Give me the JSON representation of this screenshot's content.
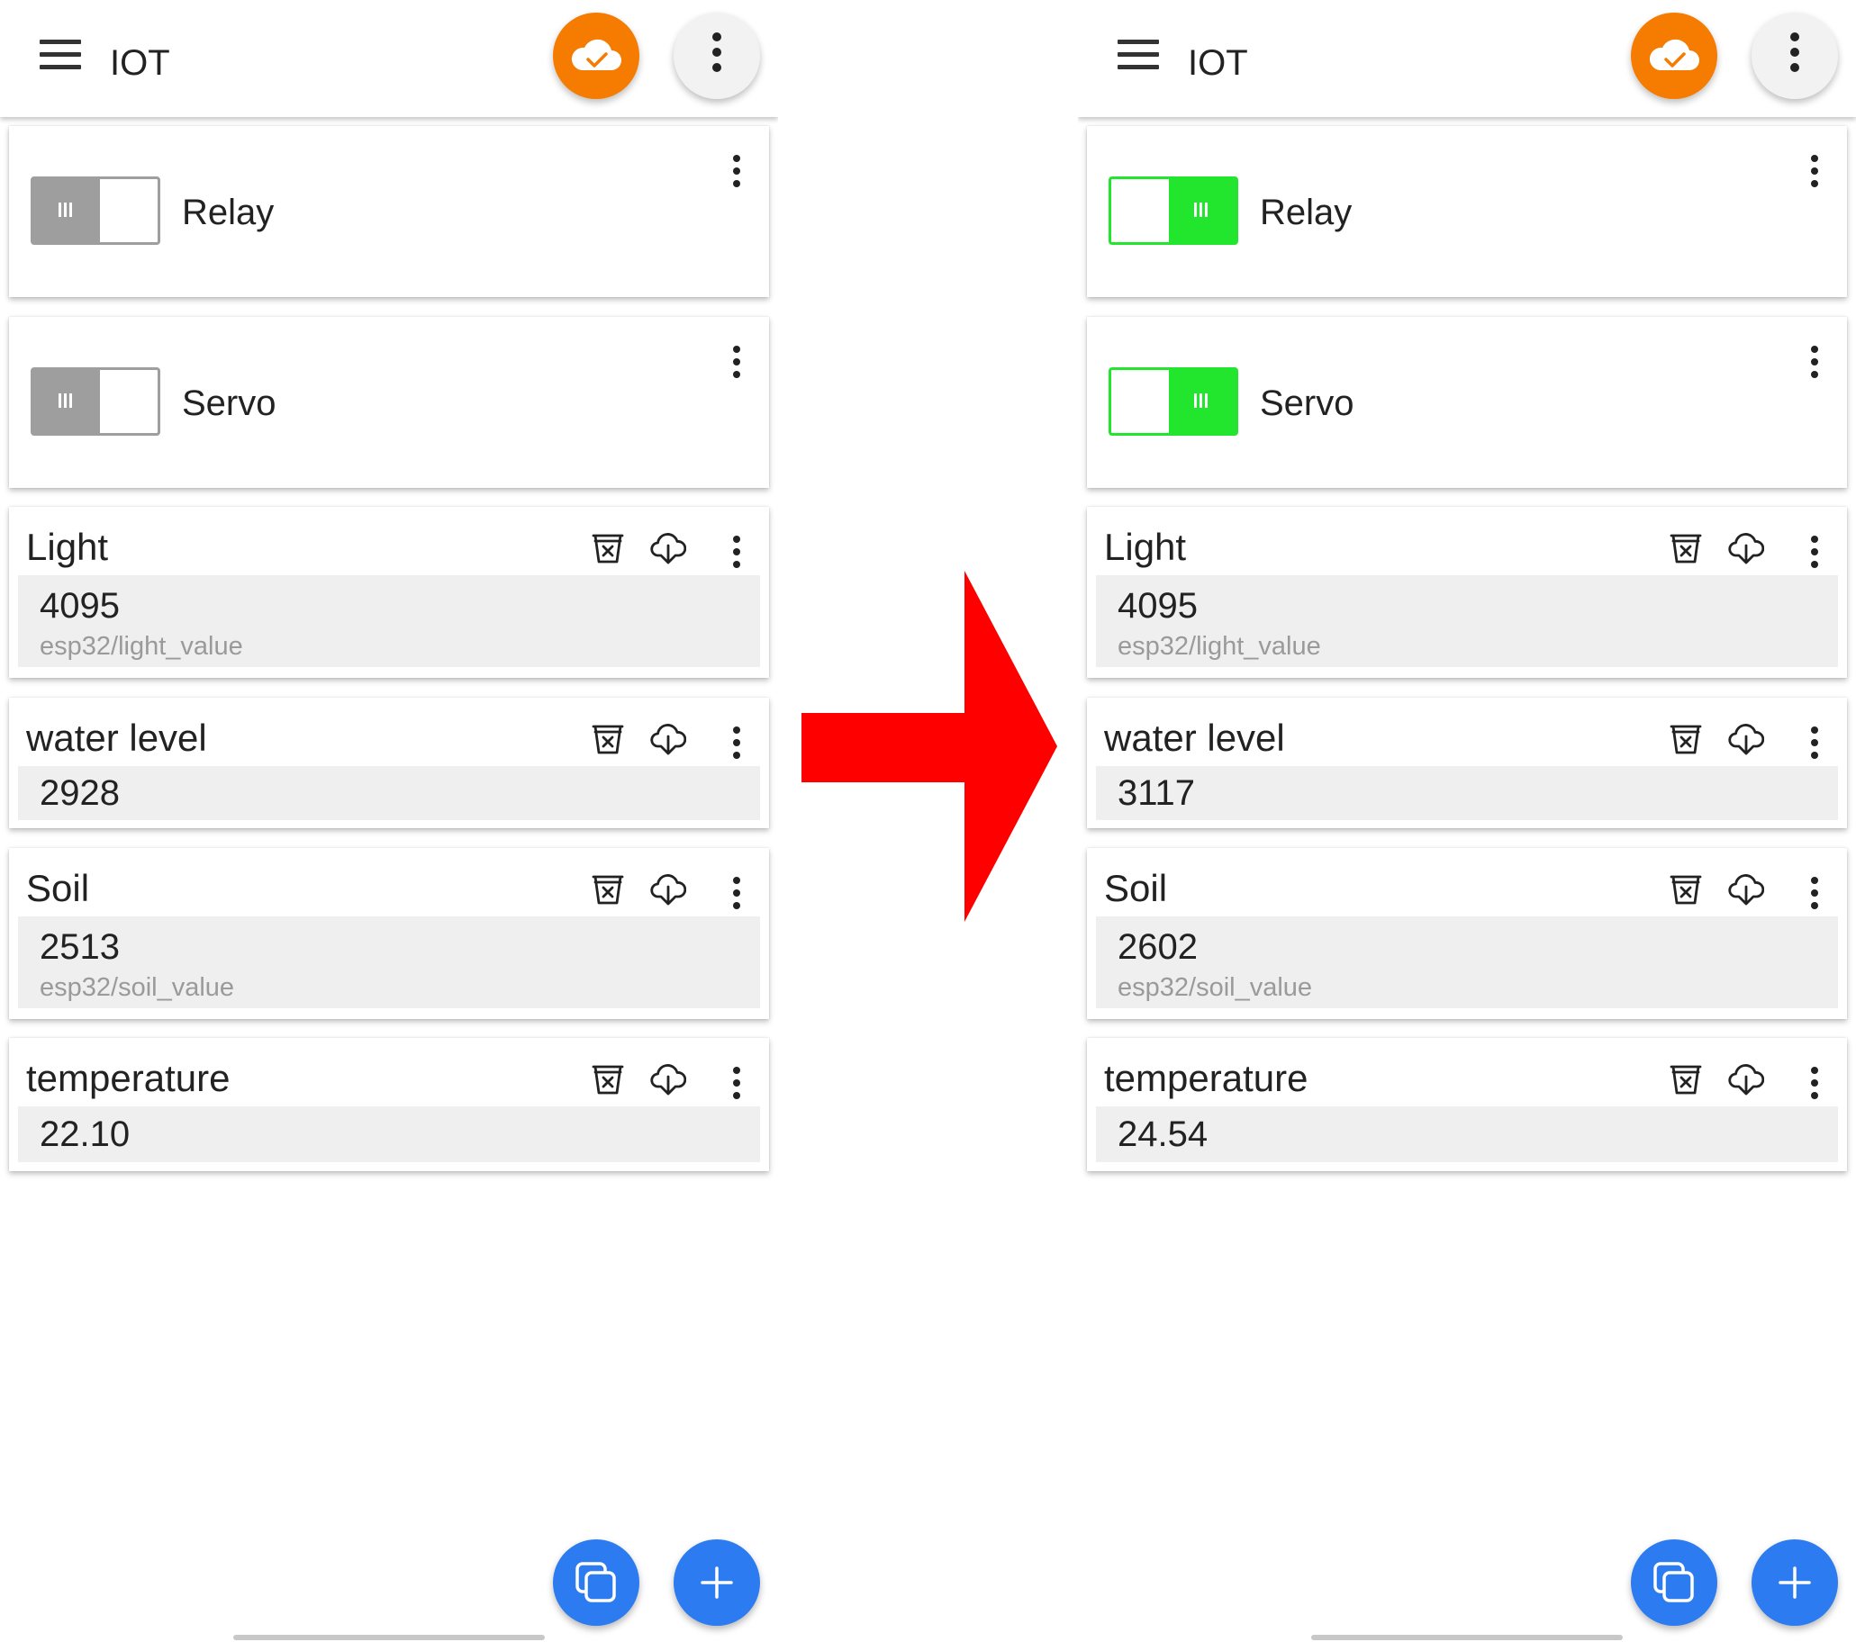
{
  "screens": [
    {
      "app_title": "IOT",
      "toggles": [
        {
          "label": "Relay",
          "state": "off"
        },
        {
          "label": "Servo",
          "state": "off"
        }
      ],
      "sensors": [
        {
          "title": "Light",
          "value": "4095",
          "topic": "esp32/light_value"
        },
        {
          "title": "water level",
          "value": "2928"
        },
        {
          "title": "Soil",
          "value": "2513",
          "topic": "esp32/soil_value"
        },
        {
          "title": "temperature",
          "value": "22.10"
        }
      ]
    },
    {
      "app_title": "IOT",
      "toggles": [
        {
          "label": "Relay",
          "state": "on"
        },
        {
          "label": "Servo",
          "state": "on"
        }
      ],
      "sensors": [
        {
          "title": "Light",
          "value": "4095",
          "topic": "esp32/light_value"
        },
        {
          "title": "water level",
          "value": "3117"
        },
        {
          "title": "Soil",
          "value": "2602",
          "topic": "esp32/soil_value"
        },
        {
          "title": "temperature",
          "value": "24.54"
        }
      ]
    }
  ],
  "colors": {
    "accent_orange": "#f57c00",
    "fab_blue": "#2c7bf0",
    "switch_on": "#22e52e",
    "switch_off": "#9e9e9e",
    "arrow_red": "#ff0000"
  },
  "icons": {
    "menu": "hamburger-icon",
    "cloud_connected": "cloud-check-icon",
    "overflow": "more-vert-icon",
    "clear_retained": "delete-box-icon",
    "cloud_download": "cloud-download-icon",
    "copy": "copy-icon",
    "add": "plus-icon",
    "transition": "right-arrow"
  }
}
